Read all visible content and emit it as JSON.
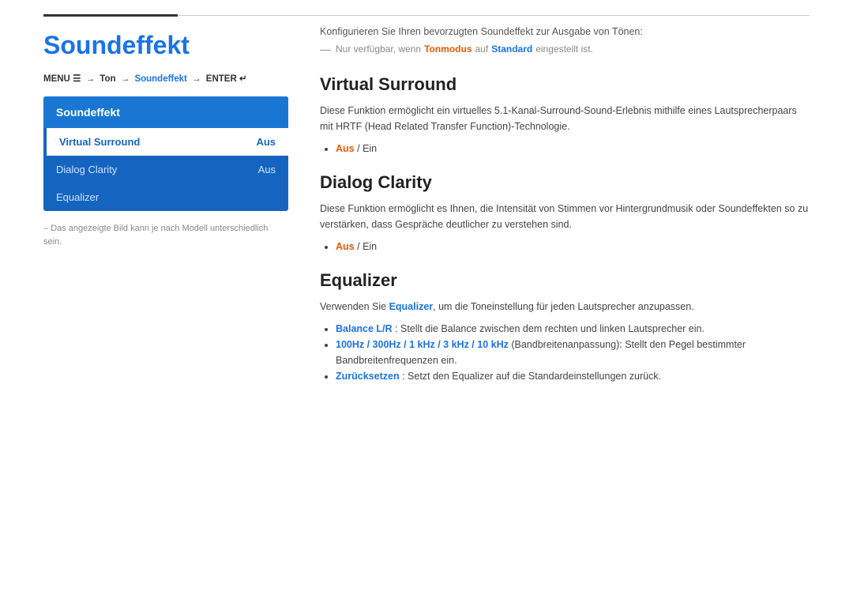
{
  "topbar": {},
  "left": {
    "title": "Soundeffekt",
    "breadcrumb": {
      "menu": "MENU",
      "menu_icon": "☰",
      "arrow1": "→",
      "ton": "Ton",
      "arrow2": "→",
      "soundeffekt": "Soundeffekt",
      "arrow3": "→",
      "enter": "ENTER",
      "enter_icon": "↵"
    },
    "nav": {
      "header": "Soundeffekt",
      "items": [
        {
          "label": "Virtual Surround",
          "value": "Aus",
          "active": true
        },
        {
          "label": "Dialog Clarity",
          "value": "Aus",
          "active": false
        },
        {
          "label": "Equalizer",
          "value": "",
          "active": false
        }
      ]
    },
    "note": "Das angezeigte Bild kann je nach Modell unterschiedlich sein."
  },
  "right": {
    "intro": "Konfigurieren Sie Ihren bevorzugten Soundeffekt zur Ausgabe von Tönen:",
    "avail_note_prefix": "Nur verfügbar, wenn",
    "avail_tonmodus": "Tonmodus",
    "avail_auf": "auf",
    "avail_standard": "Standard",
    "avail_note_suffix": "eingestellt ist.",
    "sections": [
      {
        "title": "Virtual Surround",
        "desc": "Diese Funktion ermöglicht ein virtuelles 5.1-Kanal-Surround-Sound-Erlebnis mithilfe eines Lautsprecherpaars mit HRTF (Head Related Transfer Function)-Technologie.",
        "bullet": "Aus / Ein"
      },
      {
        "title": "Dialog Clarity",
        "desc": "Diese Funktion ermöglicht es Ihnen, die Intensität von Stimmen vor Hintergrundmusik oder Soundeffekten so zu verstärken, dass Gespräche deutlicher zu verstehen sind.",
        "bullet": "Aus / Ein"
      },
      {
        "title": "Equalizer",
        "desc": "Verwenden Sie Equalizer, um die Toneinstellung für jeden Lautsprecher anzupassen.",
        "bullets": [
          {
            "bold": "Balance L/R",
            "text": ": Stellt die Balance zwischen dem rechten und linken Lautsprecher ein."
          },
          {
            "bold": "100Hz / 300Hz / 1 kHz / 3 kHz / 10 kHz",
            "text": " (Bandbreitenanpassung): Stellt den Pegel bestimmter Bandbreitenfrequenzen ein."
          },
          {
            "bold": "Zurücksetzen",
            "text": ": Setzt den Equalizer auf die Standardeinstellungen zurück."
          }
        ]
      }
    ]
  }
}
